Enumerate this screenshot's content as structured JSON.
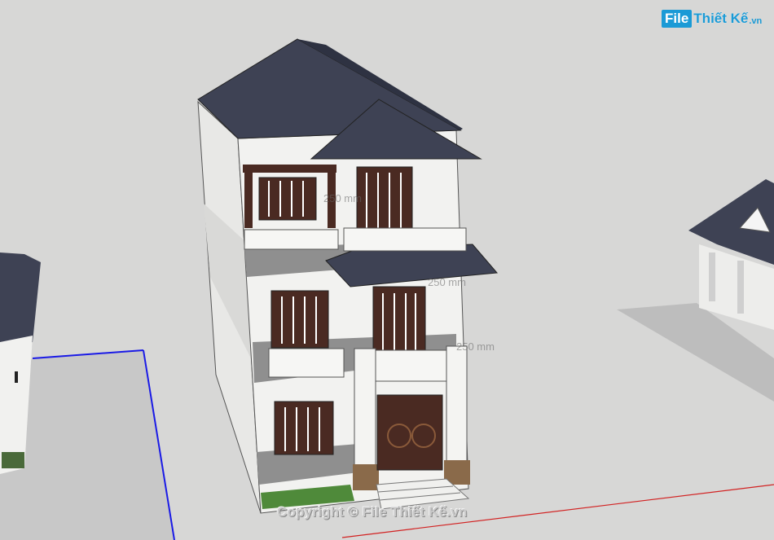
{
  "watermark": {
    "logo_badge": "File",
    "logo_text": "Thiết Kế",
    "logo_tld": ".vn",
    "copyright": "Copyright © File Thiết Kế.vn"
  },
  "dimension_labels": [
    "250 mm",
    "250 mm",
    "250 mm"
  ],
  "colors": {
    "background": "#d7d7d6",
    "roof": "#3e4254",
    "wall": "#f2f2f0",
    "wood": "#4a2a22",
    "axis_blue": "#1a1ae6",
    "axis_red": "#d22222",
    "brand": "#1a9ad6"
  }
}
